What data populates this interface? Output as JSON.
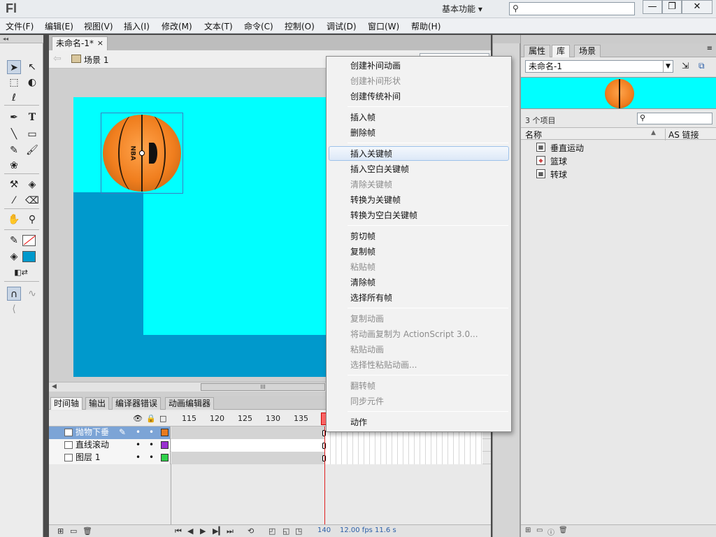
{
  "app": {
    "logo": "Fl",
    "workspace": "基本功能 ▾",
    "window_controls": [
      "—",
      "❐",
      "✕"
    ]
  },
  "menubar": [
    "文件(F)",
    "编辑(E)",
    "视图(V)",
    "插入(I)",
    "修改(M)",
    "文本(T)",
    "命令(C)",
    "控制(O)",
    "调试(D)",
    "窗口(W)",
    "帮助(H)"
  ],
  "toolbar": {
    "tools": [
      "selection-arrow-icon",
      "subselection-icon",
      "free-transform-icon",
      "3d-rotation-icon",
      "lasso-icon",
      "pen-icon",
      "text-icon",
      "line-icon",
      "rectangle-icon",
      "pencil-icon",
      "brush-icon",
      "deco-icon",
      "bone-icon",
      "paint-bucket-icon",
      "eyedropper-icon",
      "eraser-icon",
      "hand-icon",
      "zoom-icon",
      "stroke-color-icon",
      "fill-color-icon",
      "swap-colors-icon",
      "snap-icon",
      "smooth-icon"
    ],
    "text_tool_glyph": "T",
    "fill_color": "#0099cc",
    "stroke_color": "#ffffff"
  },
  "document": {
    "tab_title": "未命名-1*",
    "tab_close": "×",
    "scene_label": "场景 1"
  },
  "stage": {
    "background": "#00ffff",
    "shape_color": "#0099cc",
    "ball_text": "NBA"
  },
  "scroll_thumb": "III",
  "timeline": {
    "tabs": [
      "时间轴",
      "输出",
      "编译器错误",
      "动画编辑器"
    ],
    "ruler": [
      "115",
      "120",
      "125",
      "130",
      "135"
    ],
    "header_icons": [
      "👁",
      "🔒",
      "□"
    ],
    "layers": [
      {
        "name": "抛物下垂",
        "color": "#e87a1e",
        "selected": true,
        "pencil": "✎"
      },
      {
        "name": "直线滚动",
        "color": "#9a2fd0",
        "selected": false
      },
      {
        "name": "图层 1",
        "color": "#2fd04a",
        "selected": false
      }
    ],
    "dot": "•",
    "footer": {
      "frame": "140",
      "fps": "12.00 fps",
      "time": "11.6 s"
    }
  },
  "context_menu": {
    "items": [
      {
        "label": "创建补间动画",
        "enabled": true
      },
      {
        "label": "创建补间形状",
        "enabled": false
      },
      {
        "label": "创建传统补间",
        "enabled": true
      },
      {
        "sep": true
      },
      {
        "label": "插入帧",
        "enabled": true
      },
      {
        "label": "删除帧",
        "enabled": true
      },
      {
        "sep": true
      },
      {
        "label": "插入关键帧",
        "enabled": true,
        "highlighted": true
      },
      {
        "label": "插入空白关键帧",
        "enabled": true
      },
      {
        "label": "清除关键帧",
        "enabled": false
      },
      {
        "label": "转换为关键帧",
        "enabled": true
      },
      {
        "label": "转换为空白关键帧",
        "enabled": true
      },
      {
        "sep": true
      },
      {
        "label": "剪切帧",
        "enabled": true
      },
      {
        "label": "复制帧",
        "enabled": true
      },
      {
        "label": "粘贴帧",
        "enabled": false
      },
      {
        "label": "清除帧",
        "enabled": true
      },
      {
        "label": "选择所有帧",
        "enabled": true
      },
      {
        "sep": true
      },
      {
        "label": "复制动画",
        "enabled": false
      },
      {
        "label": "将动画复制为 ActionScript 3.0...",
        "enabled": false
      },
      {
        "label": "粘贴动画",
        "enabled": false
      },
      {
        "label": "选择性粘贴动画...",
        "enabled": false
      },
      {
        "sep": true
      },
      {
        "label": "翻转帧",
        "enabled": false
      },
      {
        "label": "同步元件",
        "enabled": false
      },
      {
        "sep": true
      },
      {
        "label": "动作",
        "enabled": true
      }
    ]
  },
  "library": {
    "tabs": [
      "属性",
      "库",
      "场景"
    ],
    "doc_select": "未命名-1",
    "count": "3 个项目",
    "col_name": "名称",
    "col_link": "AS 链接",
    "sort_glyph": "▲",
    "items": [
      {
        "name": "垂直运动",
        "icon": "movie-clip-icon"
      },
      {
        "name": "篮球",
        "icon": "graphic-icon"
      },
      {
        "name": "转球",
        "icon": "movie-clip-icon"
      }
    ]
  }
}
